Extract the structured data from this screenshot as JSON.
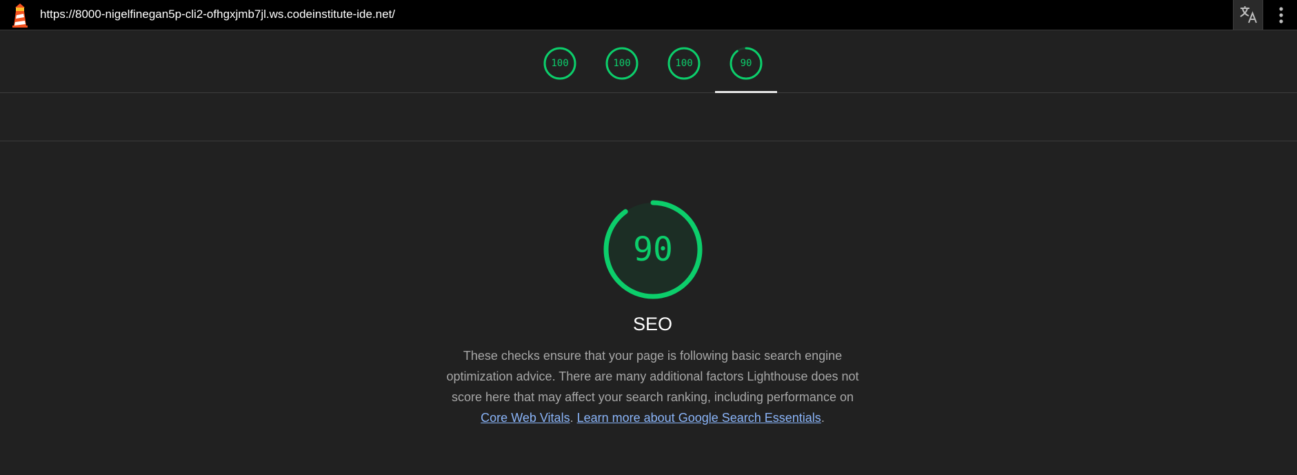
{
  "browser": {
    "url": "https://8000-nigelfinegan5p-cli2-ofhgxjmb7jl.ws.codeinstitute-ide.net/"
  },
  "scores": [
    {
      "value": "100",
      "fraction": 1.0
    },
    {
      "value": "100",
      "fraction": 1.0
    },
    {
      "value": "100",
      "fraction": 1.0
    },
    {
      "value": "90",
      "fraction": 0.9
    }
  ],
  "category": {
    "score": "90",
    "score_fraction": 0.9,
    "title": "SEO",
    "description": "These checks ensure that your page is following basic search engine optimization advice. There are many additional factors Lighthouse does not score here that may affect your search ranking, including performance on ",
    "link_core_web_vitals": "Core Web Vitals",
    "separator": ". ",
    "link_learn_more": "Learn more about Google Search Essentials",
    "end": "."
  },
  "colors": {
    "pass": "#0cce6b",
    "background": "#212121",
    "link": "#8ab4f8"
  },
  "icons": {
    "logo": "lighthouse-logo-icon",
    "translate": "translate-icon",
    "menu": "more-vert-icon"
  }
}
